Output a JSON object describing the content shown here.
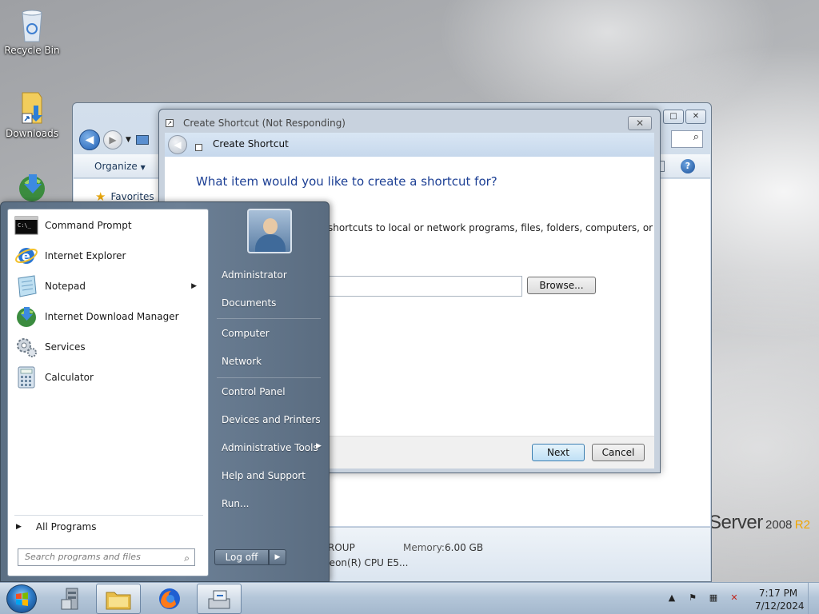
{
  "desktop": {
    "icons": [
      {
        "label": "Recycle Bin",
        "icon": "recycle-bin-icon"
      },
      {
        "label": "Downloads",
        "icon": "folder-shortcut-icon"
      },
      {
        "label": "",
        "icon": "internet-download-manager-icon"
      }
    ],
    "brand": {
      "word": "Server",
      "year": "2008",
      "release": "R2"
    }
  },
  "explorer": {
    "organize_label": "Organize",
    "favorites_label": "Favorites",
    "details": {
      "workgroup_fragment": "ROUP",
      "memory_key": "Memory:",
      "memory_value": "6.00 GB",
      "cpu_fragment": "Xeon(R) CPU E5..."
    }
  },
  "dialog": {
    "title": "Create Shortcut (Not Responding)",
    "wizard_title": "Create Shortcut",
    "question": "What item would you like to create a shortcut for?",
    "description_fragment": "shortcuts to local or network programs, files, folders, computers, or",
    "location_value": "",
    "browse_label": "Browse...",
    "next_label": "Next",
    "cancel_label": "Cancel",
    "close_glyph": "✕"
  },
  "start_menu": {
    "pinned": [
      {
        "label": "Command Prompt",
        "icon": "command-prompt-icon",
        "submenu": false
      },
      {
        "label": "Internet Explorer",
        "icon": "internet-explorer-icon",
        "submenu": false
      },
      {
        "label": "Notepad",
        "icon": "notepad-icon",
        "submenu": true
      },
      {
        "label": "Internet Download Manager",
        "icon": "internet-download-manager-icon",
        "submenu": false
      },
      {
        "label": "Services",
        "icon": "services-icon",
        "submenu": false
      },
      {
        "label": "Calculator",
        "icon": "calculator-icon",
        "submenu": false
      }
    ],
    "all_programs_label": "All Programs",
    "search_placeholder": "Search programs and files",
    "right_links": [
      {
        "label": "Administrator",
        "submenu": false
      },
      {
        "label": "Documents",
        "submenu": false
      },
      {
        "label": "Computer",
        "submenu": false
      },
      {
        "label": "Network",
        "submenu": false
      },
      {
        "label": "Control Panel",
        "submenu": false
      },
      {
        "label": "Devices and Printers",
        "submenu": false
      },
      {
        "label": "Administrative Tools",
        "submenu": true
      },
      {
        "label": "Help and Support",
        "submenu": false
      },
      {
        "label": "Run...",
        "submenu": false
      }
    ],
    "logoff_label": "Log off"
  },
  "taskbar": {
    "apps": [
      {
        "name": "server-manager",
        "icon": "server-manager-icon",
        "active": false
      },
      {
        "name": "windows-explorer",
        "icon": "folder-icon",
        "active": true
      },
      {
        "name": "firefox",
        "icon": "firefox-icon",
        "active": false
      },
      {
        "name": "shortcut-wizard",
        "icon": "wizard-icon",
        "active": true
      }
    ],
    "clock": {
      "time": "7:17 PM",
      "date": "7/12/2024"
    }
  },
  "colors": {
    "accent_blue": "#1c3f94",
    "start_menu_panel": "#6c8096",
    "taskbar": "#b4c6d9"
  }
}
